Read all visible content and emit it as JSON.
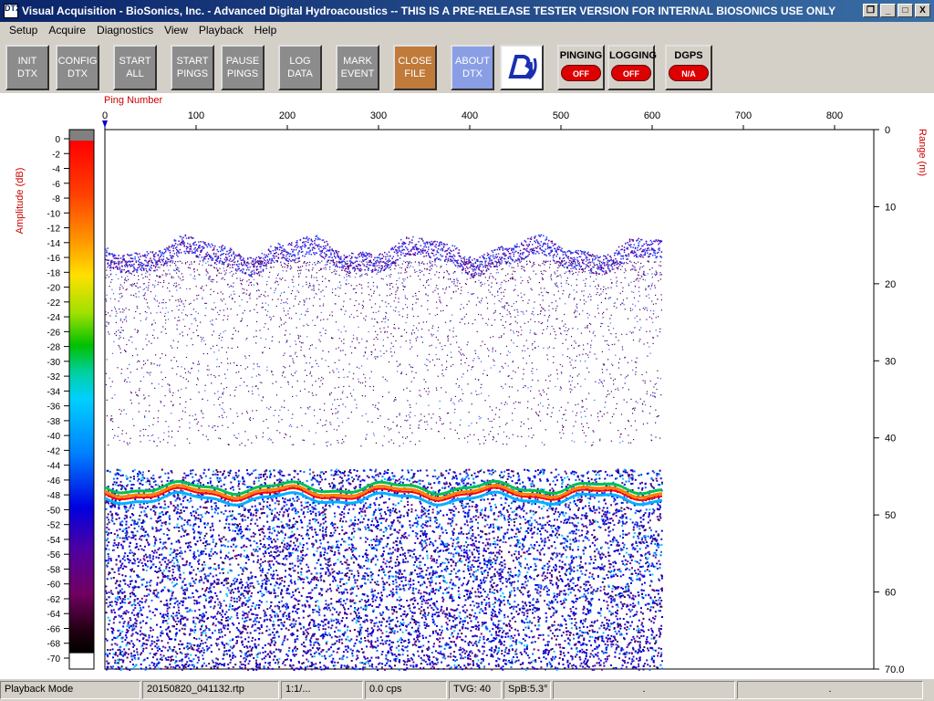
{
  "window": {
    "icon_text": "DTX",
    "title": "Visual Acquisition  -  BioSonics, Inc.  -  Advanced Digital Hydroacoustics  -- THIS IS A PRE-RELEASE TESTER VERSION FOR INTERNAL BIOSONICS USE ONLY",
    "buttons": [
      "❐",
      "_",
      "□",
      "X"
    ]
  },
  "menu": [
    "Setup",
    "Acquire",
    "Diagnostics",
    "View",
    "Playback",
    "Help"
  ],
  "toolbar": {
    "init_dtx": "INIT\nDTX",
    "config_dtx": "CONFIG\nDTX",
    "start_all": "START\nALL",
    "start_pings": "START\nPINGS",
    "pause_pings": "PAUSE\nPINGS",
    "log_data": "LOG\nDATA",
    "mark_event": "MARK\nEVENT",
    "close_file": "CLOSE\nFILE",
    "about_dtx": "ABOUT\nDTX",
    "pinging_label": "PINGING",
    "pinging_state": "OFF",
    "logging_label": "LOGGING",
    "logging_state": "OFF",
    "dgps_label": "DGPS",
    "dgps_state": "N/A"
  },
  "echogram": {
    "x_axis_label": "Ping Number",
    "x_ticks": [
      "0",
      "100",
      "200",
      "300",
      "400",
      "500",
      "600",
      "700",
      "800"
    ],
    "y_axis_label": "Range (m)",
    "y_ticks": [
      "0",
      "10",
      "20",
      "30",
      "40",
      "50",
      "60",
      "70.0"
    ],
    "colorbar_label": "Amplitude (dB)",
    "colorbar_ticks": [
      "0",
      "-2",
      "-4",
      "-6",
      "-8",
      "-10",
      "-12",
      "-14",
      "-16",
      "-18",
      "-20",
      "-22",
      "-24",
      "-26",
      "-28",
      "-30",
      "-32",
      "-34",
      "-36",
      "-38",
      "-40",
      "-42",
      "-44",
      "-46",
      "-48",
      "-50",
      "-52",
      "-54",
      "-56",
      "-58",
      "-60",
      "-62",
      "-64",
      "-66",
      "-68",
      "-70"
    ],
    "ping_count": 610,
    "max_ping": 850,
    "max_range_m": 70,
    "min_db": -70,
    "colors": {
      "label": "#cc0000",
      "marker": "#0000cc"
    }
  },
  "status": {
    "mode": "Playback Mode",
    "file": "20150820_041132.rtp",
    "ratio": "1:1/...",
    "rate": "0.0 cps",
    "tvg": "TVG: 40",
    "spb": "SpB:5.3°",
    "extra1": ".",
    "extra2": "."
  }
}
